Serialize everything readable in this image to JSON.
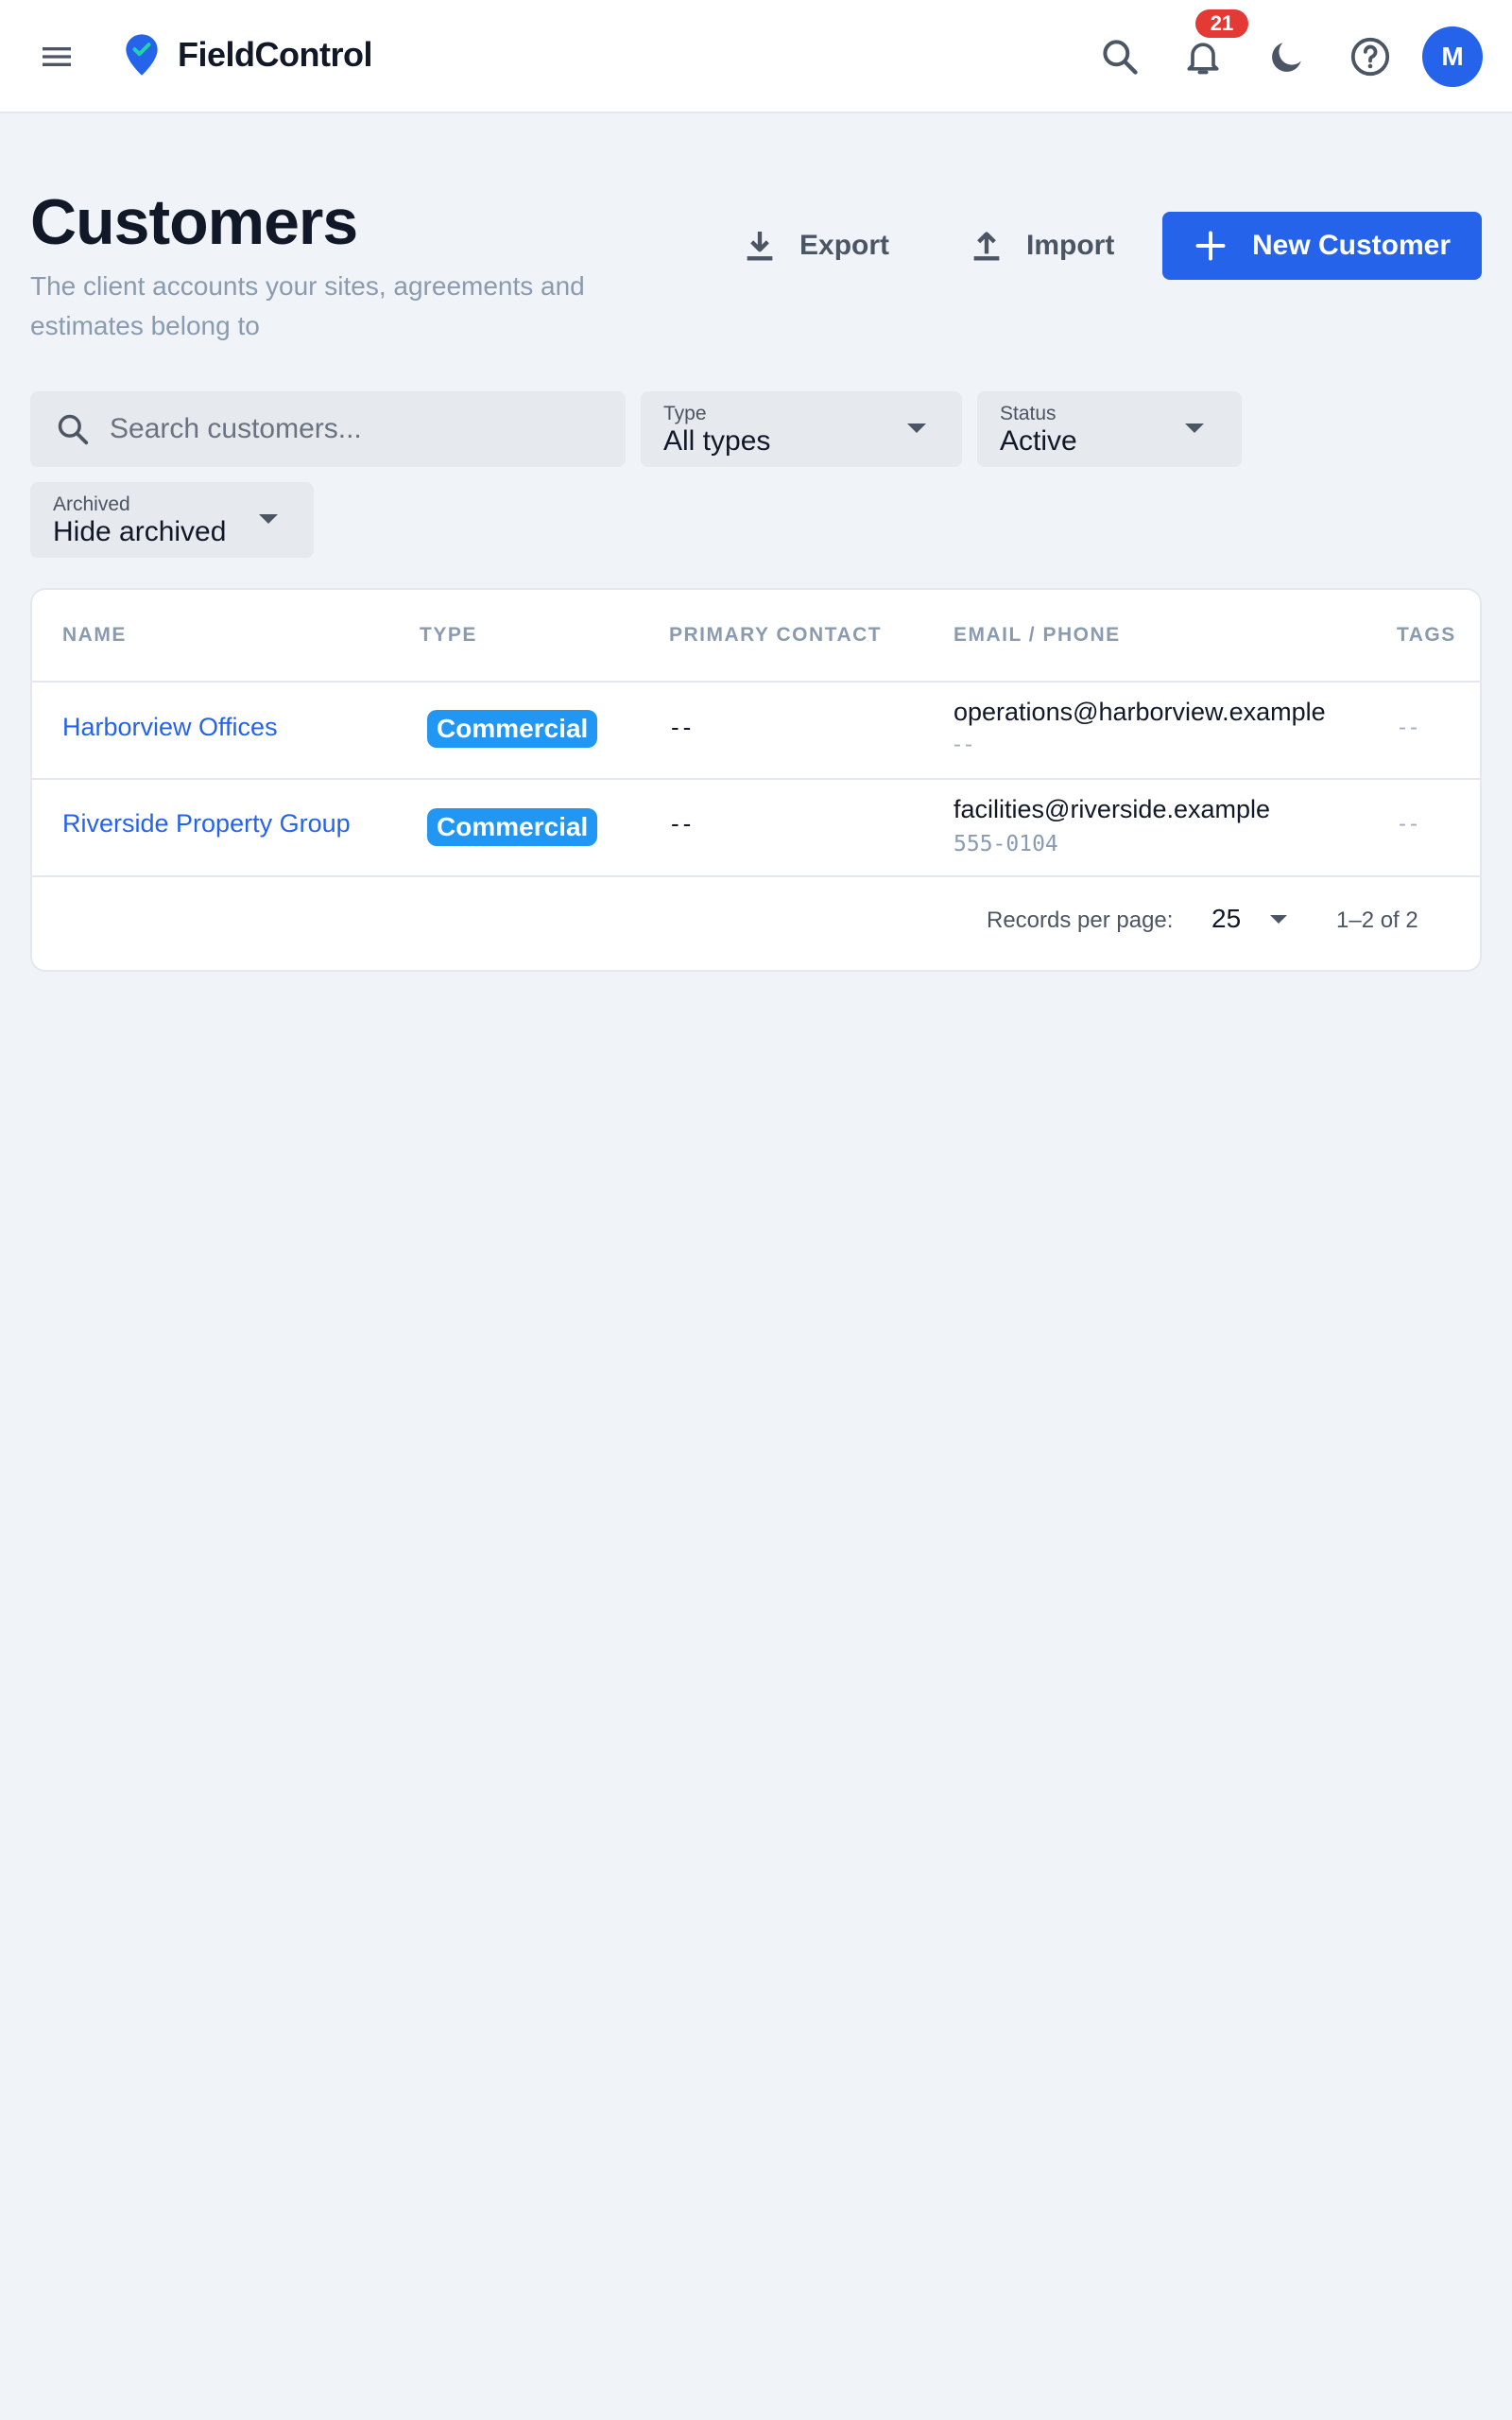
{
  "app": {
    "name": "FieldControl",
    "notification_count": "21",
    "avatar_initial": "M",
    "accent_color": "#2563eb",
    "icons": [
      "menu-icon",
      "map-pin-check-icon",
      "search-icon",
      "bell-icon",
      "moon-icon",
      "help-circle-icon"
    ]
  },
  "header": {
    "title": "Customers",
    "subtitle": "The client accounts your sites, agreements and estimates belong to",
    "export_label": "Export",
    "import_label": "Import",
    "new_label": "New Customer"
  },
  "filters": {
    "search_placeholder": "Search customers...",
    "type": {
      "label": "Type",
      "value": "All types"
    },
    "status": {
      "label": "Status",
      "value": "Active"
    },
    "archived": {
      "label": "Archived",
      "value": "Hide archived"
    }
  },
  "table": {
    "columns": [
      "NAME",
      "TYPE",
      "PRIMARY CONTACT",
      "EMAIL / PHONE",
      "TAGS"
    ],
    "rows": [
      {
        "name": "Harborview Offices",
        "type": "Commercial",
        "contact": "--",
        "email": "operations@harborview.example",
        "phone": "--",
        "tags": "--"
      },
      {
        "name": "Riverside Property Group",
        "type": "Commercial",
        "contact": "--",
        "email": "facilities@riverside.example",
        "phone": "555-0104",
        "tags": "--"
      }
    ]
  },
  "pagination": {
    "label": "Records per page:",
    "per_page": "25",
    "range": "1–2 of 2"
  }
}
